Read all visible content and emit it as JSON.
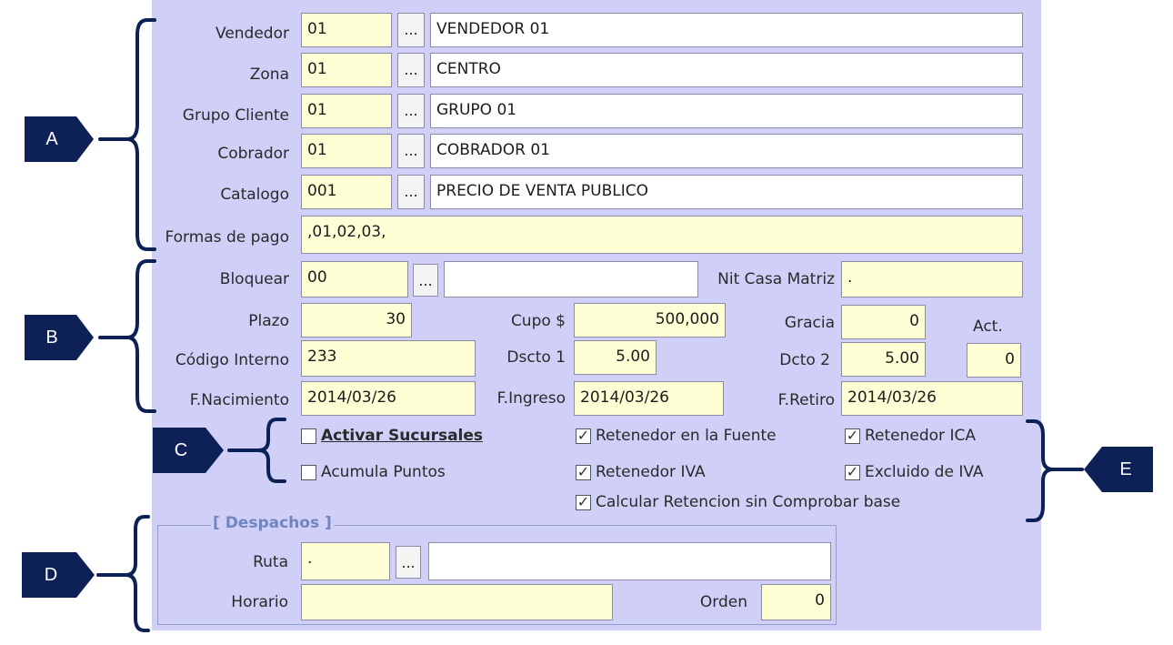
{
  "section_a": {
    "rows": [
      {
        "label": "Vendedor",
        "code": "01",
        "button": "...",
        "desc": "VENDEDOR 01"
      },
      {
        "label": "Zona",
        "code": "01",
        "button": "...",
        "desc": "CENTRO"
      },
      {
        "label": "Grupo Cliente",
        "code": "01",
        "button": "...",
        "desc": "GRUPO 01"
      },
      {
        "label": "Cobrador",
        "code": "01",
        "button": "...",
        "desc": "COBRADOR 01"
      },
      {
        "label": "Catalogo",
        "code": "001",
        "button": "...",
        "desc": "PRECIO DE VENTA PUBLICO"
      }
    ],
    "formas_label": "Formas de pago",
    "formas_value": ",01,02,03,"
  },
  "section_b": {
    "bloquear_label": "Bloquear",
    "bloquear_code": "00",
    "bloquear_button": "...",
    "bloquear_desc": "",
    "nit_label": "Nit Casa Matriz",
    "nit_value": ".",
    "plazo_label": "Plazo",
    "plazo_value": "30",
    "cupo_label": "Cupo $",
    "cupo_value": "500,000",
    "gracia_label": "Gracia",
    "gracia_value": "0",
    "act_label": "Act.",
    "codigo_label": "Código Interno",
    "codigo_value": "233",
    "dscto1_label": "Dscto 1",
    "dscto1_value": "5.00",
    "dcto2_label": "Dcto 2",
    "dcto2_value": "5.00",
    "act_value": "0",
    "nacimiento_label": "F.Nacimiento",
    "nacimiento_value": "2014/03/26",
    "ingreso_label": "F.Ingreso",
    "ingreso_value": "2014/03/26",
    "retiro_label": "F.Retiro",
    "retiro_value": "2014/03/26"
  },
  "checkboxes": {
    "activar_sucursales": {
      "label": "Activar Sucursales",
      "checked": false
    },
    "acumula_puntos": {
      "label": "Acumula Puntos",
      "checked": false
    },
    "retenedor_fuente": {
      "label": "Retenedor en la Fuente",
      "checked": true
    },
    "retenedor_iva": {
      "label": "Retenedor IVA",
      "checked": true
    },
    "calcular_retencion": {
      "label": "Calcular Retencion sin Comprobar base",
      "checked": true
    },
    "retenedor_ica": {
      "label": "Retenedor ICA",
      "checked": true
    },
    "excluido_iva": {
      "label": "Excluido de IVA",
      "checked": true
    }
  },
  "despachos": {
    "title": "[ Despachos ]",
    "ruta_label": "Ruta",
    "ruta_code": ".",
    "ruta_button": "...",
    "ruta_desc": "",
    "horario_label": "Horario",
    "horario_value": "",
    "orden_label": "Orden",
    "orden_value": "0"
  },
  "annotations": {
    "a": "A",
    "b": "B",
    "c": "C",
    "d": "D",
    "e": "E"
  },
  "colors": {
    "panel": "#cfcff7",
    "field_yellow": "#ffffd6",
    "annotation": "#0e2157",
    "group_title": "#6f86c0"
  }
}
